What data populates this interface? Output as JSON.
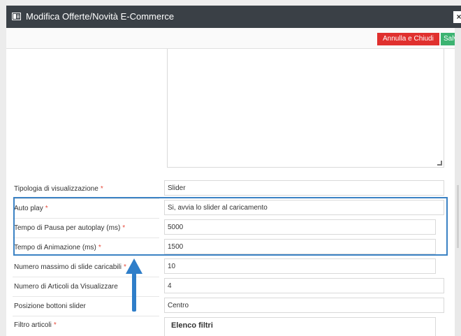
{
  "window": {
    "title": "Modifica Offerte/Novità E-Commerce",
    "close_label": "×"
  },
  "toolbar": {
    "cancel_label": "Annulla e Chiudi",
    "save_label": "Salva"
  },
  "form": {
    "required_marker": "*",
    "fields": [
      {
        "label": "Tipologia di visualizzazione",
        "required": true,
        "value": "Slider"
      },
      {
        "label": "Auto play",
        "required": true,
        "value": "Si, avvia lo slider al caricamento"
      },
      {
        "label": "Tempo di Pausa per autoplay (ms)",
        "required": true,
        "value": "5000"
      },
      {
        "label": "Tempo di Animazione (ms)",
        "required": true,
        "value": "1500"
      },
      {
        "label": "Numero massimo di slide caricabili",
        "required": true,
        "value": "10"
      },
      {
        "label": "Numero di Articoli da Visualizzare",
        "required": false,
        "value": "4"
      },
      {
        "label": "Posizione bottoni slider",
        "required": false,
        "value": "Centro"
      },
      {
        "label": "Filtro articoli",
        "required": true,
        "value": "Elenco filtri"
      }
    ]
  },
  "annotation": {
    "highlight_color": "#3b82c4",
    "arrow_color": "#2f7ec9"
  }
}
